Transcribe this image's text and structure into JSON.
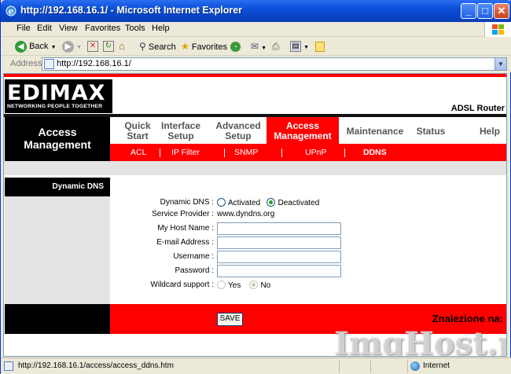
{
  "window": {
    "title": "http://192.168.16.1/ - Microsoft Internet Explorer",
    "min_glyph": "_",
    "max_glyph": "□",
    "close_glyph": "✕"
  },
  "menu": [
    "File",
    "Edit",
    "View",
    "Favorites",
    "Tools",
    "Help"
  ],
  "toolbar": {
    "back_label": "Back",
    "search_label": "Search",
    "favorites_label": "Favorites"
  },
  "address": {
    "label": "Address",
    "url": "http://192.168.16.1/"
  },
  "router": {
    "logo_text": "EDIMAX",
    "logo_tagline": "NETWORKING PEOPLE TOGETHER",
    "model": "ADSL Router",
    "section_title_line1": "Access",
    "section_title_line2": "Management",
    "tabs": [
      {
        "line1": "Quick",
        "line2": "Start"
      },
      {
        "line1": "Interface",
        "line2": "Setup"
      },
      {
        "line1": "Advanced",
        "line2": "Setup"
      },
      {
        "line1": "Access",
        "line2": "Management"
      },
      {
        "line1": "Maintenance",
        "line2": ""
      },
      {
        "line1": "Status",
        "line2": ""
      },
      {
        "line1": "Help",
        "line2": ""
      }
    ],
    "subtabs": [
      "ACL",
      "IP Filter",
      "SNMP",
      "UPnP",
      "DDNS"
    ],
    "left_header": "Dynamic DNS"
  },
  "form": {
    "dynamic_dns_label": "Dynamic DNS :",
    "activated_label": "Activated",
    "deactivated_label": "Deactivated",
    "service_provider_label": "Service Provider :",
    "service_provider_value": "www.dyndns.org",
    "host_name_label": "My Host Name :",
    "host_name_value": "",
    "email_label": "E-mail Address :",
    "email_value": "",
    "username_label": "Username :",
    "username_value": "",
    "password_label": "Password :",
    "password_value": "",
    "wildcard_label": "Wildcard support :",
    "yes_label": "Yes",
    "no_label": "No",
    "save_label": "SAVE"
  },
  "footer_text": "Znalezione na:",
  "watermark": "ImgHost.pl",
  "status": {
    "url": "http://192.168.16.1/access/access_ddns.htm",
    "zone": "Internet"
  }
}
